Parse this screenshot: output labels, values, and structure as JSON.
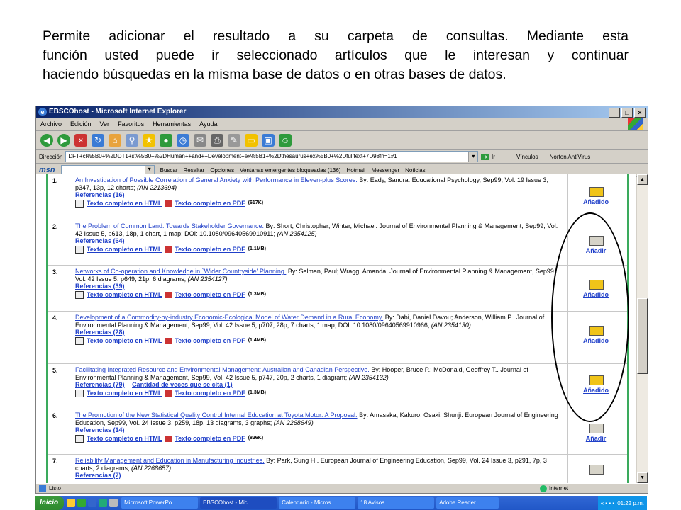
{
  "caption": {
    "line1": "Permite adicionar el resultado a su carpeta de consultas.  Mediante esta",
    "line2": "función usted puede ir seleccionado artículos que le interesan y continuar",
    "line3": "haciendo búsquedas en la misma base de datos o en otras bases de datos."
  },
  "window": {
    "title": "EBSCOhost - Microsoft Internet Explorer",
    "menu": [
      "Archivo",
      "Edición",
      "Ver",
      "Favoritos",
      "Herramientas",
      "Ayuda"
    ],
    "address_label": "Dirección",
    "address_url": "DFT+cl%5B0+%2DDT1+st%5B0+%2DHuman++and++Development+ex%5B1+%2Dthesaurus+ex%5B0+%2Dfulltext+7D98fn=1#1",
    "go_label": "Ir",
    "links_label": "Vínculos",
    "norton_label": "Norton AntiVirus",
    "msn_label": "msn",
    "buscar_label": "Buscar",
    "resaltar_label": "Resaltar",
    "opciones_label": "Opciones",
    "popups_label": "Ventanas emergentes bloqueadas (136)",
    "hotmail_label": "Hotmail",
    "messenger_label": "Messenger",
    "noticias_label": "Noticias",
    "status_text": "Listo",
    "zone_text": "Internet"
  },
  "results": [
    {
      "num": "1.",
      "title": "An Investigation of Possible Correlation of General Anxiety with Performance in Eleven-plus Scores.",
      "meta": "By: Eady, Sandra. Educational Psychology, Sep99, Vol. 19 Issue 3, p347, 13p, 12 charts;",
      "an": "(AN 2213694)",
      "refs": "Referencias (16)",
      "extra": "",
      "html": "Texto completo en HTML",
      "pdf": "Texto completo en PDF",
      "size": "(617K)",
      "action": "Añadido"
    },
    {
      "num": "2.",
      "title": "The Problem of Common Land: Towards Stakeholder Governance.",
      "meta": "By: Short, Christopher; Winter, Michael. Journal of Environmental Planning & Management, Sep99, Vol. 42 Issue 5, p613, 18p, 1 chart, 1 map; DOI: 10.1080/09640569910911;",
      "an": "(AN 2354125)",
      "refs": "Referencias (64)",
      "extra": "",
      "html": "Texto completo en HTML",
      "pdf": "Texto completo en PDF",
      "size": "(1.1MB)",
      "action": "Añadir"
    },
    {
      "num": "3.",
      "title": "Networks of Co-operation and Knowledge in `Wider Countryside' Planning.",
      "meta": "By: Selman, Paul; Wragg, Amanda. Journal of Environmental Planning & Management, Sep99, Vol. 42 Issue 5, p649, 21p, 6 diagrams;",
      "an": "(AN 2354127)",
      "refs": "Referencias (39)",
      "extra": "",
      "html": "Texto completo en HTML",
      "pdf": "Texto completo en PDF",
      "size": "(1.3MB)",
      "action": "Añadido"
    },
    {
      "num": "4.",
      "title": "Development of a Commodity-by-industry Economic-Ecological Model of Water Demand in a Rural Economy.",
      "meta": "By: Dabi, Daniel Davou; Anderson, William P.. Journal of Environmental Planning & Management, Sep99, Vol. 42 Issue 5, p707, 28p, 7 charts, 1 map; DOI: 10.1080/09640569910966;",
      "an": "(AN 2354130)",
      "refs": "Referencias (28)",
      "extra": "",
      "html": "Texto completo en HTML",
      "pdf": "Texto completo en PDF",
      "size": "(1.4MB)",
      "action": "Añadido"
    },
    {
      "num": "5.",
      "title": "Facilitating Integrated Resource and Environmental Management: Australian and Canadian Perspective.",
      "meta": "By: Hooper, Bruce P.; McDonald, Geoffrey T.. Journal of Environmental Planning & Management, Sep99, Vol. 42 Issue 5, p747, 20p, 2 charts, 1 diagram;",
      "an": "(AN 2354132)",
      "refs": "Referencias (79)",
      "extra": "Cantidad de veces que se cita (1)",
      "html": "Texto completo en HTML",
      "pdf": "Texto completo en PDF",
      "size": "(1.3MB)",
      "action": "Añadido"
    },
    {
      "num": "6.",
      "title": "The Promotion of the New Statistical Quality Control Internal Education at Toyota Motor: A Proposal.",
      "meta": "By: Amasaka, Kakuro; Osaki, Shunji. European Journal of Engineering Education, Sep99, Vol. 24 Issue 3, p259, 18p, 13 diagrams, 3 graphs;",
      "an": "(AN 2268649)",
      "refs": "Referencias (14)",
      "extra": "",
      "html": "Texto completo en HTML",
      "pdf": "Texto completo en PDF",
      "size": "(826K)",
      "action": "Añadir"
    },
    {
      "num": "7.",
      "title": "Reliability Management and Education in Manufacturing Industries.",
      "meta": "By: Park, Sung H.. European Journal of Engineering Education, Sep99, Vol. 24 Issue 3, p291, 7p, 3 charts, 2 diagrams;",
      "an": "(AN 2268657)",
      "refs": "Referencias (7)",
      "extra": "",
      "html": "",
      "pdf": "",
      "size": "",
      "action": ""
    }
  ],
  "taskbar": {
    "start": "Inicio",
    "tasks": [
      "Microsoft PowerPo...",
      "EBSCOhost - Mic...",
      "Calendario - Micros...",
      "18 Avisos",
      "Adobe Reader"
    ],
    "clock": "01:22 p.m."
  }
}
